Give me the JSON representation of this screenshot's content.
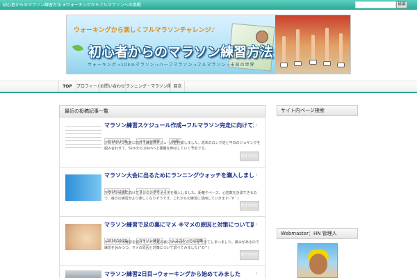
{
  "topbar": {
    "tagline": "初心者からのマラソン練習方法 ※ウォーキングからフルマラソンへの挑戦",
    "search_button": "検索",
    "search_placeholder": ""
  },
  "banner": {
    "subtitle_top": "ウォーキングから楽しくフルマラソンチャレンジ♪",
    "title": "初心者からのマラソン練習方法",
    "subtitle_bottom": "ウォーキング→10kmマラソン→ハーフマラソン→フルマラソン→未知の世界"
  },
  "nav": {
    "items": [
      "TOP",
      "プロフィール",
      "お問い合わせ",
      "ランニング・マラソン関連記事一覧",
      "目次"
    ]
  },
  "main": {
    "header": "最近の投稿記事一覧",
    "posts": [
      {
        "title": "マラソン練習スケジュール作成→フルマラソン完走に向けて頑張る(;´∀｀)",
        "date": "2016/12/08",
        "tags": [
          "マラソン練習",
          "目標"
        ],
        "excerpt": "フルマラソン完走に向けて練習スケジュールを作成しました。週末のロング走と平日のジョギングを組み合わせて、5kmから10kmへと距離を伸ばしていく予定です。",
        "more": "続きを読む"
      },
      {
        "title": "マラソン大会に出るためにランニングウォッチを購入しました(^O^)／",
        "date": "2016/12/08",
        "tags": [
          "ランニンググッズ"
        ],
        "excerpt": "マラソン大会に向けてランニングウォッチを購入しました。距離やペース、心拍数を計測できるので、毎日の練習がより楽しくなりそうです。これからの練習に活用していきます(´∀｀)",
        "more": "続きを読む"
      },
      {
        "title": "マラソン練習で足の裏にマメ ※マメの原因と対策について調べてみました",
        "date": "2016/10/25",
        "tags": [
          "マラソン練習",
          "トラブル・ケガ対策"
        ],
        "excerpt": "ランニングの練習を続けていたら足の裏に5mmほどのマメができてしまいました。痛みがあるので練習を休みつつ、マメの原因と対策について調べてみました(^O^)",
        "more": "続きを読む"
      },
      {
        "title": "マラソン練習2日目→ウォーキングから始めてみました",
        "date": "",
        "tags": [],
        "excerpt": "",
        "more": ""
      }
    ]
  },
  "sidebar": {
    "header_top": "サイト内ページ検索",
    "header_profile": "Webmaster：HN 管理人"
  },
  "colors": {
    "accent": "#2aa896",
    "link": "#1a2f8a"
  }
}
